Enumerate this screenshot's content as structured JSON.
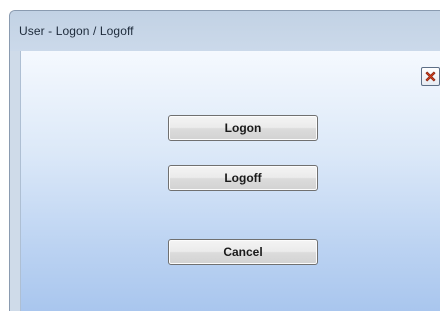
{
  "window": {
    "title": "User - Logon / Logoff"
  },
  "buttons": {
    "logon": "Logon",
    "logoff": "Logoff",
    "cancel": "Cancel"
  },
  "icons": {
    "close": "close-icon"
  },
  "colors": {
    "close_icon": "#d8431f",
    "client_top": "#f5f9fe",
    "client_bottom": "#a9c6ee"
  }
}
